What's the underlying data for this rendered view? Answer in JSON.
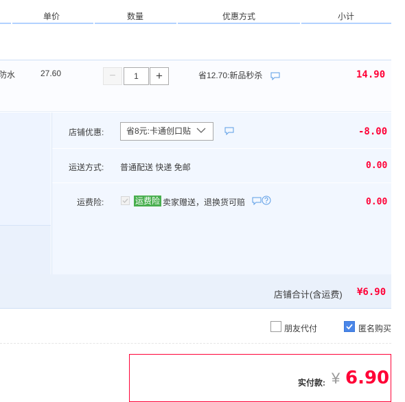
{
  "header": {
    "col_price": "单价",
    "col_qty": "数量",
    "col_discount": "优惠方式",
    "col_subtotal": "小计"
  },
  "item": {
    "title_fragment": "防水",
    "unit_price": "27.60",
    "quantity": "1",
    "discount_text": "省12.70:新品秒杀",
    "subtotal": "14.90"
  },
  "shop": {
    "coupon_label": "店铺优惠:",
    "coupon_selected": "省8元:卡通创口贴",
    "coupon_amount": "-8.00",
    "shipping_label": "运送方式:",
    "shipping_value": "普通配送 快递 免邮",
    "shipping_amount": "0.00",
    "insurance_label": "运费险:",
    "insurance_tag": "运费险",
    "insurance_text": "卖家赠送，退换货可赔",
    "insurance_amount": "0.00",
    "total_label": "店铺合计(含运费)",
    "total_amount": "¥6.90"
  },
  "options": {
    "friend_pay_label": "朋友代付",
    "friend_pay_checked": false,
    "anonymous_label": "匿名购买",
    "anonymous_checked": true
  },
  "pay": {
    "label": "实付款:",
    "currency": "¥",
    "amount": "6.90"
  },
  "colors": {
    "accent_red": "#ff0036",
    "accent_blue": "#4a86e8",
    "tag_green": "#49af4f"
  },
  "icons": [
    "message-icon",
    "question-icon",
    "chevron-down-icon",
    "checkmark-icon"
  ]
}
